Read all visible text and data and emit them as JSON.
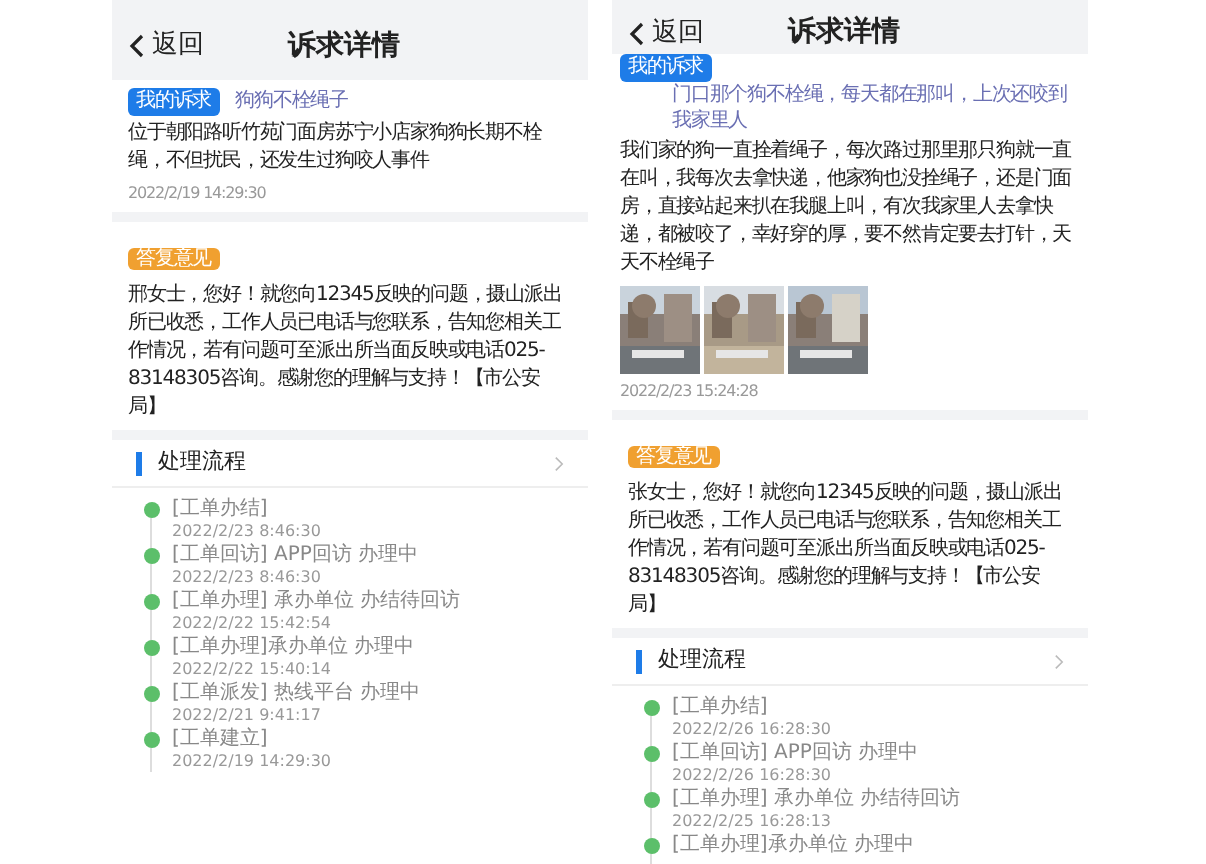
{
  "screens": [
    {
      "back": "返回",
      "title": "诉求详情",
      "complaint": {
        "tag": "我的诉求",
        "kind": "inline",
        "subject": "狗狗不栓绳子",
        "body": "位于朝阳路听竹苑门面房苏宁小店家狗狗长期不栓绳，不但扰民，还发生过狗咬人事件",
        "time": "2022/2/19 14:29:30"
      },
      "reply": {
        "tag": "答复意见",
        "body": "邢女士，您好！就您向12345反映的问题，摄山派出所已收悉，工作人员已电话与您联系，告知您相关工作情况，若有问题可至派出所当面反映或电话025-83148305咨询。感谢您的理解与支持！【市公安局】"
      },
      "process": {
        "title": "处理流程",
        "steps": [
          {
            "text": "[工单办结]",
            "time": "2022/2/23 8:46:30"
          },
          {
            "text": "[工单回访] APP回访 办理中",
            "time": "2022/2/23 8:46:30"
          },
          {
            "text": "[工单办理] 承办单位 办结待回访",
            "time": "2022/2/22 15:42:54"
          },
          {
            "text": "[工单办理]承办单位 办理中",
            "time": "2022/2/22 15:40:14"
          },
          {
            "text": "[工单派发] 热线平台 办理中",
            "time": "2022/2/21 9:41:17"
          },
          {
            "text": "[工单建立]",
            "time": "2022/2/19 14:29:30"
          }
        ]
      }
    },
    {
      "back": "返回",
      "title": "诉求详情",
      "complaint": {
        "tag": "我的诉求",
        "subject": "门口那个狗不栓绳，每天都在那叫，上次还咬到我家里人",
        "kind": "stacked",
        "body": "我们家的狗一直拴着绳子，每次路过那里那只狗就一直在叫，我每次去拿快递，他家狗也没拴绳子，还是门面房，直接站起来扒在我腿上叫，有次我家里人去拿快递，都被咬了，幸好穿的厚，要不然肯定要去打针，天天不栓绳子",
        "time": "2022/2/23 15:24:28"
      },
      "reply": {
        "tag": "答复意见",
        "body": "张女士，您好！就您向12345反映的问题，摄山派出所已收悉，工作人员已电话与您联系，告知您相关工作情况，若有问题可至派出所当面反映或电话025-83148305咨询。感谢您的理解与支持！【市公安局】"
      },
      "process": {
        "title": "处理流程",
        "steps": [
          {
            "text": "[工单办结]",
            "time": "2022/2/26 16:28:30"
          },
          {
            "text": "[工单回访] APP回访 办理中",
            "time": "2022/2/26 16:28:30"
          },
          {
            "text": "[工单办理] 承办单位 办结待回访",
            "time": "2022/2/25 16:28:13"
          },
          {
            "text": "[工单办理]承办单位 办理中"
          }
        ]
      }
    }
  ]
}
